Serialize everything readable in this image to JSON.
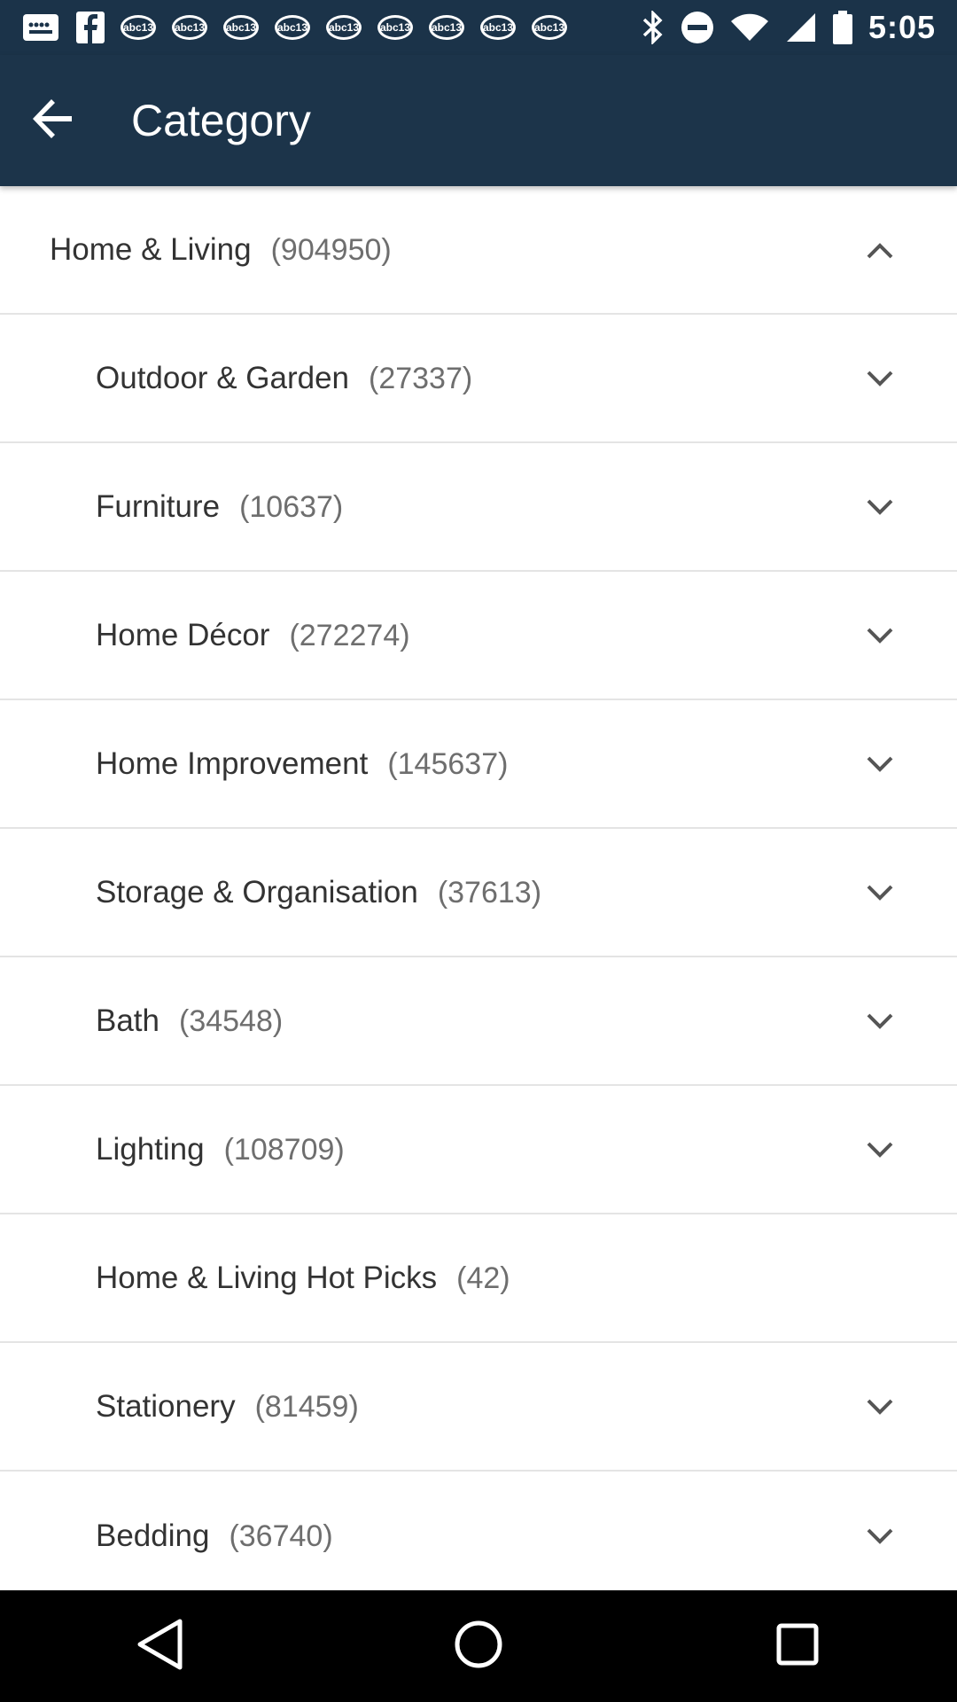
{
  "status_bar": {
    "badges": [
      "abc13",
      "abc13",
      "abc13",
      "abc13",
      "abc13",
      "abc13",
      "abc13",
      "abc13",
      "abc13"
    ],
    "time": "5:05",
    "icons": [
      "message-icon",
      "facebook-icon",
      "bluetooth-icon",
      "do-not-disturb-icon",
      "wifi-icon",
      "signal-icon",
      "battery-icon"
    ]
  },
  "app_bar": {
    "title": "Category",
    "back_icon": "arrow-back-icon"
  },
  "categories": [
    {
      "name": "Home & Living",
      "count": "(904950)",
      "level": "parent",
      "expanded": true
    },
    {
      "name": "Outdoor & Garden",
      "count": "(27337)",
      "level": "child",
      "expanded": false
    },
    {
      "name": "Furniture",
      "count": "(10637)",
      "level": "child",
      "expanded": false
    },
    {
      "name": "Home Décor",
      "count": "(272274)",
      "level": "child",
      "expanded": false
    },
    {
      "name": "Home Improvement",
      "count": "(145637)",
      "level": "child",
      "expanded": false
    },
    {
      "name": "Storage & Organisation",
      "count": "(37613)",
      "level": "child",
      "expanded": false
    },
    {
      "name": "Bath",
      "count": "(34548)",
      "level": "child",
      "expanded": false
    },
    {
      "name": "Lighting",
      "count": "(108709)",
      "level": "child",
      "expanded": false
    },
    {
      "name": "Home & Living Hot Picks",
      "count": "(42)",
      "level": "child",
      "expanded": null
    },
    {
      "name": "Stationery",
      "count": "(81459)",
      "level": "child",
      "expanded": false
    },
    {
      "name": "Bedding",
      "count": "(36740)",
      "level": "child",
      "expanded": false
    }
  ],
  "nav_bar": {
    "icons": [
      "back-triangle-icon",
      "home-circle-icon",
      "recents-square-icon"
    ]
  },
  "colors": {
    "app_bar": "#1c344a",
    "divider": "#e4e4e4",
    "text_primary": "#333333",
    "text_secondary": "#6e6e6e"
  }
}
